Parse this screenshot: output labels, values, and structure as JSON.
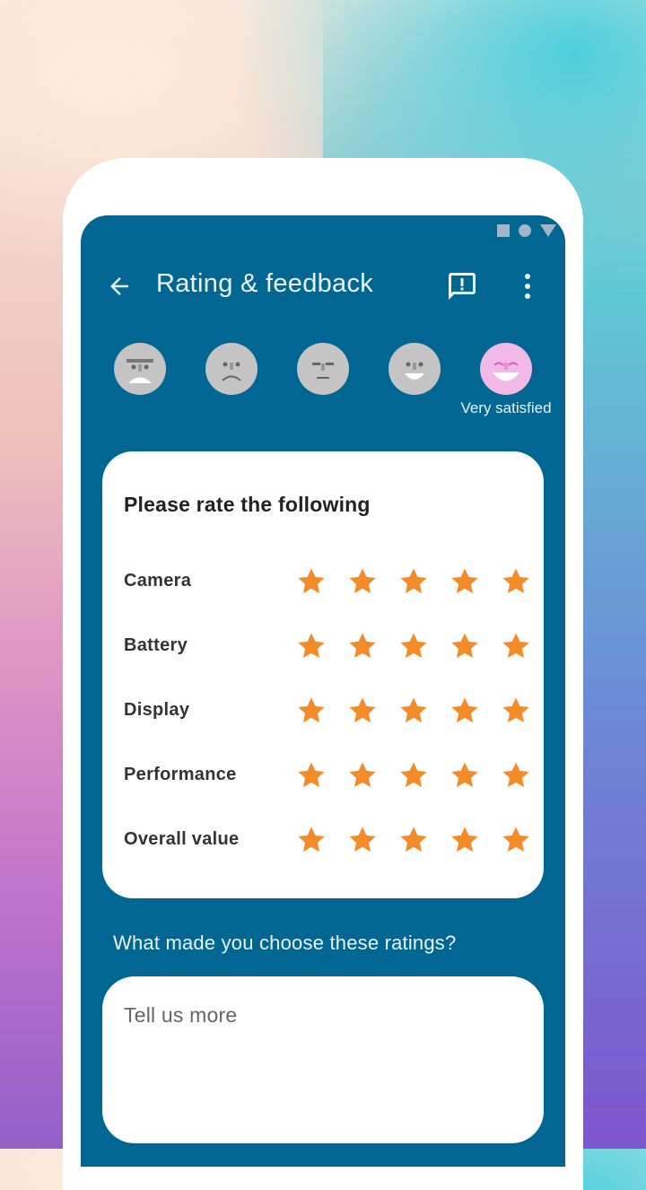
{
  "app": {
    "title": "Rating & feedback"
  },
  "faces": {
    "selected_index": 4,
    "selected_label": "Very satisfied",
    "items": [
      "very-dissatisfied",
      "dissatisfied",
      "neutral",
      "satisfied",
      "very-satisfied"
    ]
  },
  "ratings": {
    "heading": "Please rate the following",
    "max": 5,
    "star_color": "#f58b26",
    "items": [
      {
        "label": "Camera",
        "value": 5
      },
      {
        "label": "Battery",
        "value": 5
      },
      {
        "label": "Display",
        "value": 5
      },
      {
        "label": "Performance",
        "value": 5
      },
      {
        "label": "Overall value",
        "value": 5
      }
    ]
  },
  "feedback": {
    "question": "What made you choose these ratings?",
    "placeholder": "Tell us more"
  },
  "colors": {
    "screen_bg": "#016692",
    "face_default": "#c4c4c4",
    "face_selected": "#f2b9e6"
  }
}
